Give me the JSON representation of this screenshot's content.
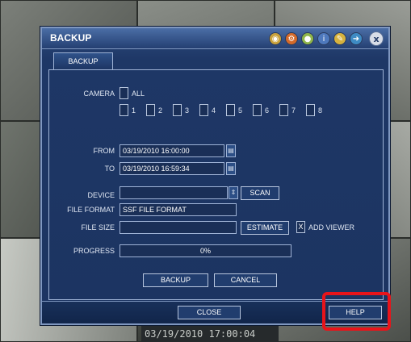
{
  "dialog": {
    "title": "BACKUP",
    "toolbar_icons": [
      "disk-icon",
      "network-icon",
      "record-icon",
      "info-icon",
      "setup-icon",
      "exit-icon"
    ],
    "close_label": "x",
    "tab": "BACKUP"
  },
  "form": {
    "camera_label": "CAMERA",
    "all_label": "ALL",
    "channels": [
      "1",
      "2",
      "3",
      "4",
      "5",
      "6",
      "7",
      "8"
    ],
    "from_label": "FROM",
    "from_value": "03/19/2010 16:00:00",
    "to_label": "TO",
    "to_value": "03/19/2010 16:59:34",
    "device_label": "DEVICE",
    "device_value": "",
    "scan_label": "SCAN",
    "file_format_label": "FILE FORMAT",
    "file_format_value": "SSF FILE FORMAT",
    "file_size_label": "FILE SIZE",
    "file_size_value": "",
    "estimate_label": "ESTIMATE",
    "viewer_check": "X",
    "add_viewer_label": "ADD VIEWER",
    "progress_label": "PROGRESS",
    "progress_value": 0,
    "progress_text": "0%",
    "backup_label": "BACKUP",
    "cancel_label": "CANCEL"
  },
  "footer": {
    "close_label": "CLOSE",
    "help_label": "HELP"
  },
  "camera_timestamp": "03/19/2010 17:00:04",
  "colors": {
    "dialog_bg": "#1e3766",
    "border": "#9fb3d6",
    "highlight": "#e8141a"
  }
}
